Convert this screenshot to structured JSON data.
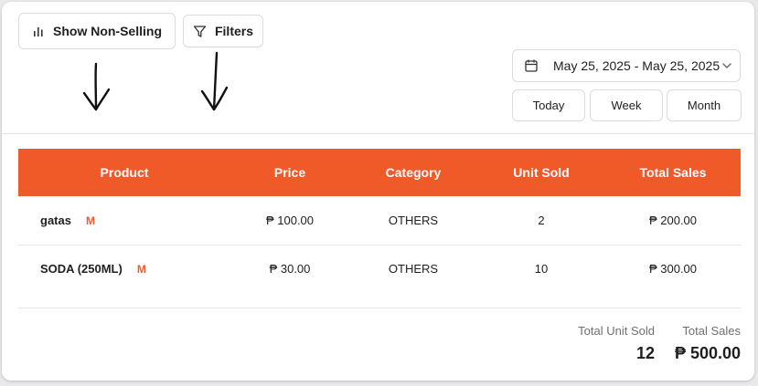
{
  "toolbar": {
    "show_non_selling_label": "Show Non-Selling",
    "filters_label": "Filters"
  },
  "date_filter": {
    "range_text": "May 25, 2025 - May 25, 2025",
    "periods": [
      "Today",
      "Week",
      "Month"
    ]
  },
  "table": {
    "columns": [
      "Product",
      "Price",
      "Category",
      "Unit Sold",
      "Total Sales"
    ],
    "rows": [
      {
        "product": "gatas",
        "badge": "M",
        "price": "₱ 100.00",
        "category": "OTHERS",
        "unit_sold": "2",
        "total_sales": "₱ 200.00"
      },
      {
        "product": "SODA (250ML)",
        "badge": "M",
        "price": "₱ 30.00",
        "category": "OTHERS",
        "unit_sold": "10",
        "total_sales": "₱ 300.00"
      }
    ]
  },
  "totals": {
    "unit_sold_label": "Total Unit Sold",
    "unit_sold_value": "12",
    "sales_label": "Total Sales",
    "sales_value": "₱ 500.00"
  },
  "colors": {
    "accent": "#f05a28",
    "header_text": "#ffffff"
  }
}
